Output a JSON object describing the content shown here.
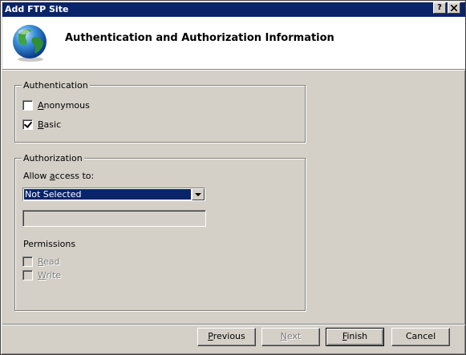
{
  "window": {
    "title": "Add FTP Site",
    "help_button": "?",
    "close_button": "X"
  },
  "header": {
    "title": "Authentication and Authorization Information",
    "icon": "globe-icon"
  },
  "authentication": {
    "legend": "Authentication",
    "anonymous": {
      "label_pre": "",
      "label_u": "A",
      "label_post": "nonymous",
      "checked": false
    },
    "basic": {
      "label_pre": "",
      "label_u": "B",
      "label_post": "asic",
      "checked": true
    }
  },
  "authorization": {
    "legend": "Authorization",
    "allow_label_pre": "Allow ",
    "allow_label_u": "a",
    "allow_label_post": "ccess to:",
    "allow_value": "Not Selected",
    "permissions_label": "Permissions",
    "read": {
      "label_pre": "",
      "label_u": "R",
      "label_post": "ead",
      "checked": false,
      "enabled": false
    },
    "write": {
      "label_pre": "",
      "label_u": "W",
      "label_post": "rite",
      "checked": false,
      "enabled": false
    }
  },
  "buttons": {
    "previous": {
      "pre": "",
      "u": "P",
      "post": "revious"
    },
    "next": {
      "pre": "",
      "u": "N",
      "post": "ext"
    },
    "finish": {
      "pre": "",
      "u": "F",
      "post": "inish"
    },
    "cancel": "Cancel"
  },
  "colors": {
    "titlebar": "#0a246a",
    "face": "#d4d0c8"
  }
}
